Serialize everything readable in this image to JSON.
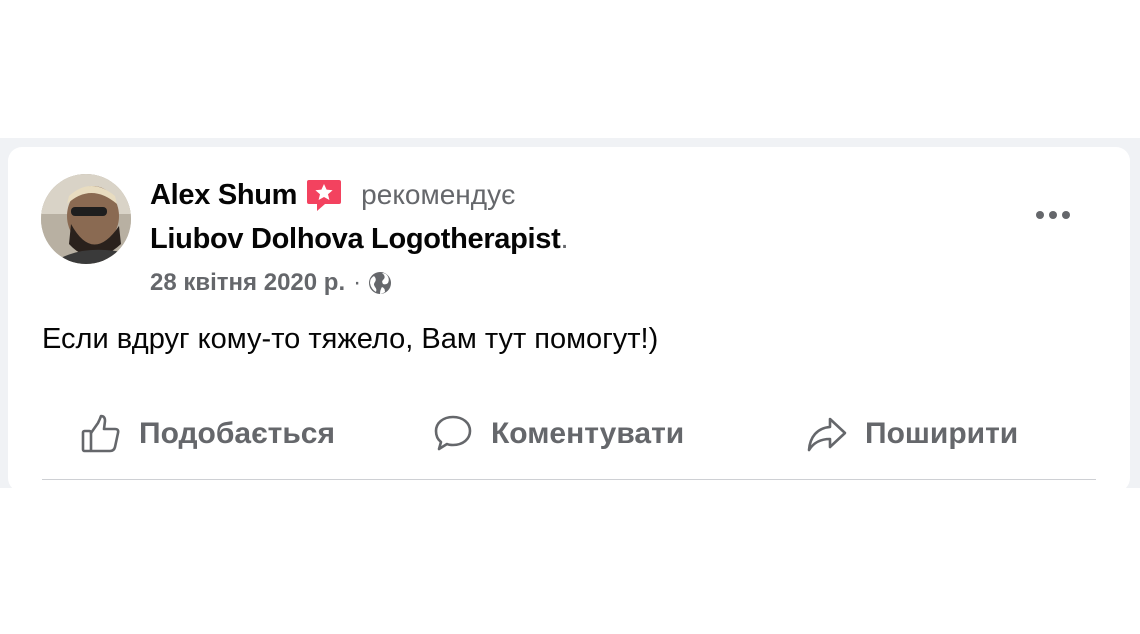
{
  "post": {
    "author": "Alex Shum",
    "recommends": "рекомендує",
    "page_name": "Liubov Dolhova Logotherapist",
    "page_suffix": ".",
    "date": "28 квітня 2020 р.",
    "separator": "·",
    "privacy_icon": "globe-icon",
    "badge_icon": "recommend-star-badge-icon",
    "text": "Если вдруг кому-то тяжело, Вам тут помогут!)"
  },
  "actions": [
    {
      "label": "Подобається",
      "icon": "like-icon"
    },
    {
      "label": "Коментувати",
      "icon": "comment-icon"
    },
    {
      "label": "Поширити",
      "icon": "share-icon"
    }
  ],
  "colors": {
    "badge": "#f3425f",
    "secondary_text": "#65676b",
    "primary_text": "#050505",
    "backdrop": "#f0f2f5"
  }
}
